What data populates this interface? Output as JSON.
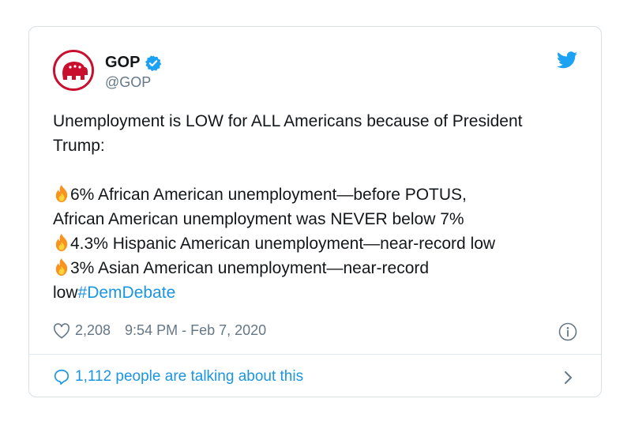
{
  "tweet": {
    "display_name": "GOP",
    "handle": "@GOP",
    "line1": "Unemployment is LOW for ALL Americans because of President",
    "line2": "Trump:",
    "item1_a": "6% African American unemployment—before POTUS,",
    "item1_b": "African American unemployment was NEVER below 7%",
    "item2": "4.3% Hispanic American unemployment—near-record low",
    "item3": "3% Asian American unemployment—near-record",
    "item3_tail": "low",
    "hashtag": "#DemDebate",
    "likes": "2,208",
    "timestamp": "9:54 PM - Feb 7, 2020",
    "talking": "1,112 people are talking about this"
  },
  "icons": {
    "avatar": "gop-elephant-logo",
    "verified": "verified-badge-icon",
    "bird": "twitter-bird-icon",
    "fire": "fire-emoji-icon",
    "heart": "heart-outline-icon",
    "info": "info-circle-icon",
    "bubble": "speech-bubble-icon",
    "chevron": "chevron-right-icon"
  },
  "colors": {
    "brand_blue": "#1da1f2",
    "link_blue": "#1b95e0",
    "gop_red": "#c8102e",
    "text": "#14171a",
    "muted": "#657786"
  }
}
